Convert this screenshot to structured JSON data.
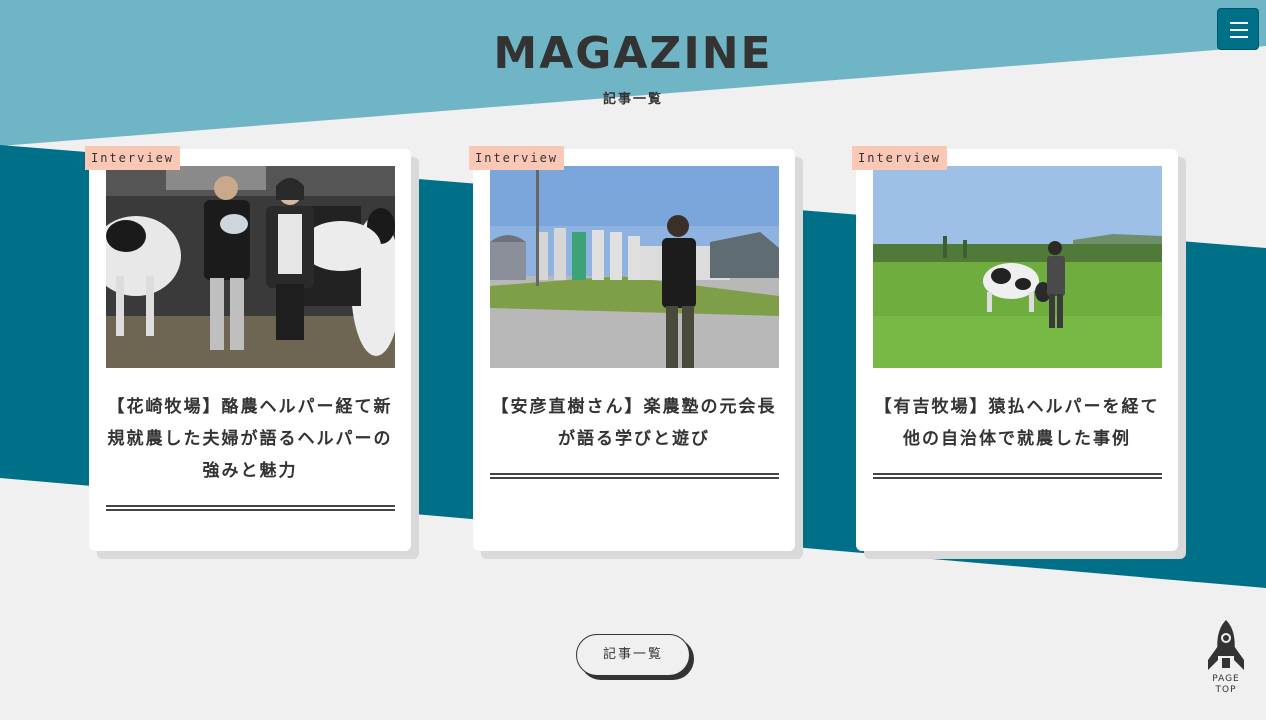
{
  "header": {
    "title": "MAGAZINE",
    "subtitle": "記事一覧"
  },
  "colors": {
    "sky": "#6fb5c5",
    "teal": "#007088",
    "background": "#f0f0f0",
    "badge": "#fbc8b6"
  },
  "cards": [
    {
      "badge": "Interview",
      "title": "【花崎牧場】酪農ヘルパー経て新規就農した夫婦が語るヘルパーの強みと魅力",
      "photo": "farm-couple-photo"
    },
    {
      "badge": "Interview",
      "title": "【安彦直樹さん】楽農塾の元会長が語る学びと遊び",
      "photo": "farm-silos-photo"
    },
    {
      "badge": "Interview",
      "title": "【有吉牧場】猿払ヘルパーを経て他の自治体で就農した事例",
      "photo": "pasture-cow-photo"
    }
  ],
  "footer": {
    "list_button": "記事一覧",
    "page_top_line1": "PAGE",
    "page_top_line2": "TOP"
  },
  "icons": {
    "menu": "hamburger-icon",
    "page_top": "rocket-icon"
  }
}
